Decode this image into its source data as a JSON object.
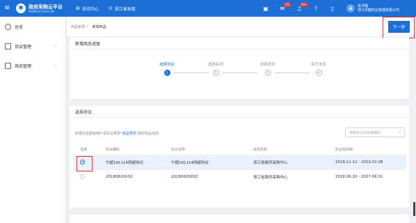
{
  "app": {
    "title": "政府采购云平台",
    "subtitle": "WWW.ZCY.GOV.CN"
  },
  "topnav": [
    {
      "icon": "grid-icon",
      "label": "协议中心"
    },
    {
      "icon": "location-icon",
      "label": "浙江省本级"
    }
  ],
  "topright": {
    "icons": [
      "calendar-icon",
      "mail-icon",
      "bell-icon",
      "help-icon",
      "lock-icon"
    ],
    "mail_badge": "155",
    "bell_badge": "99+",
    "user_name": "张洋轴",
    "user_org": "浙江天健药业管理有限公司"
  },
  "sidebar": {
    "items": [
      {
        "icon": "overview-icon",
        "label": "总览"
      },
      {
        "icon": "agreement-icon",
        "label": "协议管理",
        "chevron": "⌄"
      },
      {
        "icon": "goods-icon",
        "label": "商品管理",
        "chevron": "⌄"
      }
    ]
  },
  "breadcrumb": {
    "parent": "商品管理",
    "sep": "/",
    "current": "新增商品"
  },
  "next_button": "下一步",
  "progress": {
    "title": "新增商品进度",
    "steps": [
      {
        "label": "选择协议",
        "num": "1",
        "active": true
      },
      {
        "label": "选择标项",
        "num": "2",
        "active": false
      },
      {
        "label": "选择类目",
        "num": "3",
        "active": false
      },
      {
        "label": "填写信息",
        "num": "4",
        "active": false
      }
    ]
  },
  "agreement": {
    "title": "选择协议",
    "desc_prefix": "如果您是超级用户请先在菜单",
    "desc_link": "“商品预览”",
    "desc_suffix": "维护商品信息",
    "search_placeholder": "搜索协议名称或编码",
    "columns": [
      "选择",
      "协议编码",
      "协议名称",
      "采购机构",
      "协议有效期"
    ],
    "rows": [
      {
        "selected": true,
        "code": "宁超181114网超协议",
        "name": "宁超181114网超协议",
        "org": "浙江省政府采购中心",
        "period": "2018.11.12 - 2019.02.08"
      },
      {
        "selected": false,
        "code": "20180620002",
        "name": "20180620002",
        "org": "浙江省政府采购中心",
        "period": "2018.06.20 - 2027.06.01"
      }
    ]
  }
}
